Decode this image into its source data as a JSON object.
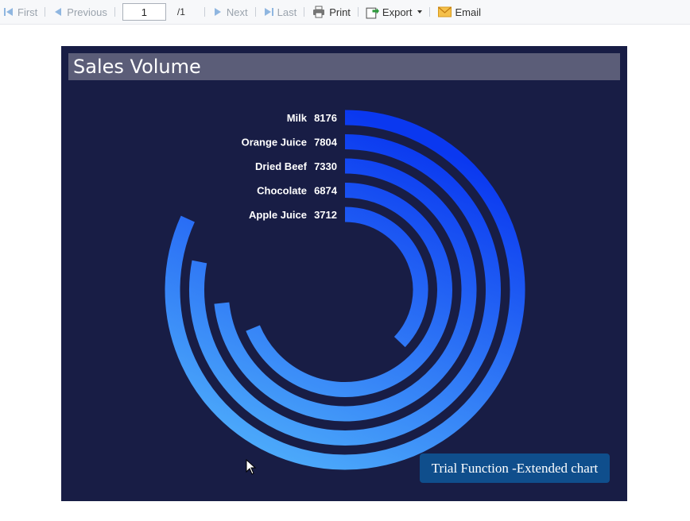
{
  "toolbar": {
    "first_label": "First",
    "previous_label": "Previous",
    "page_value": "1",
    "page_total": "/1",
    "next_label": "Next",
    "last_label": "Last",
    "print_label": "Print",
    "export_label": "Export",
    "email_label": "Email"
  },
  "colors": {
    "panel_bg": "#181d45",
    "title_bar_bg": "#5b5d78",
    "arc_start": "#0a38f0",
    "arc_end": "#52b4fb",
    "badge_bg": "#0f4e8c"
  },
  "watermark": {
    "label": "Trial Function -Extended chart"
  },
  "chart_data": {
    "type": "radial bar",
    "title": "Sales Volume",
    "categories": [
      "Milk",
      "Orange Juice",
      "Dried Beef",
      "Chocolate",
      "Apple Juice"
    ],
    "values": [
      8176,
      7804,
      7330,
      6874,
      3712
    ],
    "max": 10000,
    "legend": "none"
  }
}
